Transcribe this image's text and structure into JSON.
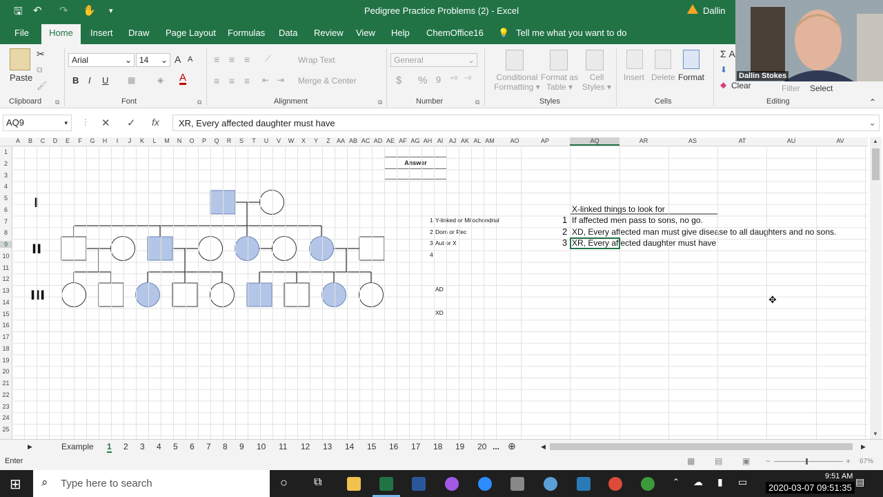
{
  "window": {
    "title": "Pedigree Practice Problems (2)  -  Excel",
    "user": "Dallin"
  },
  "menu": {
    "tabs": [
      "File",
      "Home",
      "Insert",
      "Draw",
      "Page Layout",
      "Formulas",
      "Data",
      "Review",
      "View",
      "Help",
      "ChemOffice16"
    ],
    "tell_me": "Tell me what you want to do"
  },
  "ribbon": {
    "clipboard": {
      "paste": "Paste",
      "label": "Clipboard"
    },
    "font": {
      "name": "Arial",
      "size": "14",
      "bold": "B",
      "italic": "I",
      "underline": "U",
      "label": "Font"
    },
    "alignment": {
      "wrap": "Wrap Text",
      "merge": "Merge & Center",
      "label": "Alignment"
    },
    "number": {
      "format": "General",
      "currency": "$",
      "percent": "%",
      "comma": "9",
      "label": "Number"
    },
    "styles": {
      "cond": [
        "Conditional",
        "Formatting"
      ],
      "table": [
        "Format as",
        "Table"
      ],
      "cell": [
        "Cell",
        "Styles"
      ],
      "label": "Styles"
    },
    "cells": {
      "insert": "Insert",
      "delete": "Delete",
      "format": "Format",
      "label": "Cells"
    },
    "editing": {
      "sum": "Σ A",
      "clear": "Clear",
      "filter": "Filter",
      "select": "Select",
      "label": "Editing"
    }
  },
  "formula_bar": {
    "name_box": "AQ9",
    "cancel": "✕",
    "enter": "✓",
    "fx": "fx",
    "content": "XR, Every affected daughter must have"
  },
  "grid": {
    "columns": [
      "A",
      "B",
      "C",
      "D",
      "E",
      "F",
      "G",
      "H",
      "I",
      "J",
      "K",
      "L",
      "M",
      "N",
      "O",
      "P",
      "Q",
      "R",
      "S",
      "T",
      "U",
      "V",
      "W",
      "X",
      "Y",
      "Z",
      "AA",
      "AB",
      "AC",
      "AD",
      "AE",
      "AF",
      "AG",
      "AH",
      "AI",
      "AJ",
      "AK",
      "AL",
      "AM",
      "AO",
      "AP",
      "AQ",
      "AR",
      "AS",
      "AT",
      "AU",
      "AV"
    ],
    "rows": [
      "1",
      "2",
      "3",
      "4",
      "5",
      "6",
      "7",
      "8",
      "9",
      "10",
      "11",
      "12",
      "13",
      "14",
      "15",
      "16",
      "17",
      "18",
      "19",
      "20",
      "21",
      "22",
      "23",
      "24",
      "25"
    ],
    "answer": "Answer",
    "generations": [
      "I",
      "II",
      "III"
    ],
    "list": [
      {
        "num": "1",
        "text": "Y-linked or Mitochondrial"
      },
      {
        "num": "2",
        "text": "Dom or Rec"
      },
      {
        "num": "3",
        "text": "Aut or X"
      },
      {
        "num": "4",
        "text": ""
      }
    ],
    "ad": "AD",
    "xd": "XD",
    "notes_title": "X-linked things to look for",
    "notes": [
      {
        "num": "1",
        "text": "If affected men pass to sons, no go."
      },
      {
        "num": "2",
        "text": "XD, Every affected man must give disease to all daughters and no sons."
      },
      {
        "num": "3",
        "text": "XR, Every affected daughter must have"
      }
    ]
  },
  "sheets": {
    "tabs": [
      "Example",
      "1",
      "2",
      "3",
      "4",
      "5",
      "6",
      "7",
      "8",
      "9",
      "10",
      "11",
      "12",
      "13",
      "14",
      "15",
      "16",
      "17",
      "18",
      "19",
      "20",
      "..."
    ],
    "active": "1"
  },
  "status": {
    "mode": "Enter",
    "zoom": "67%"
  },
  "taskbar": {
    "search": "Type here to search",
    "time": "9:51 AM",
    "timestamp": "2020-03-07  09:51:35"
  },
  "webcam": {
    "name": "Dallin Stokes"
  },
  "colors": {
    "excel_green": "#217346",
    "affected": "#b4c6e7",
    "affected_stroke": "#6b83b5"
  }
}
